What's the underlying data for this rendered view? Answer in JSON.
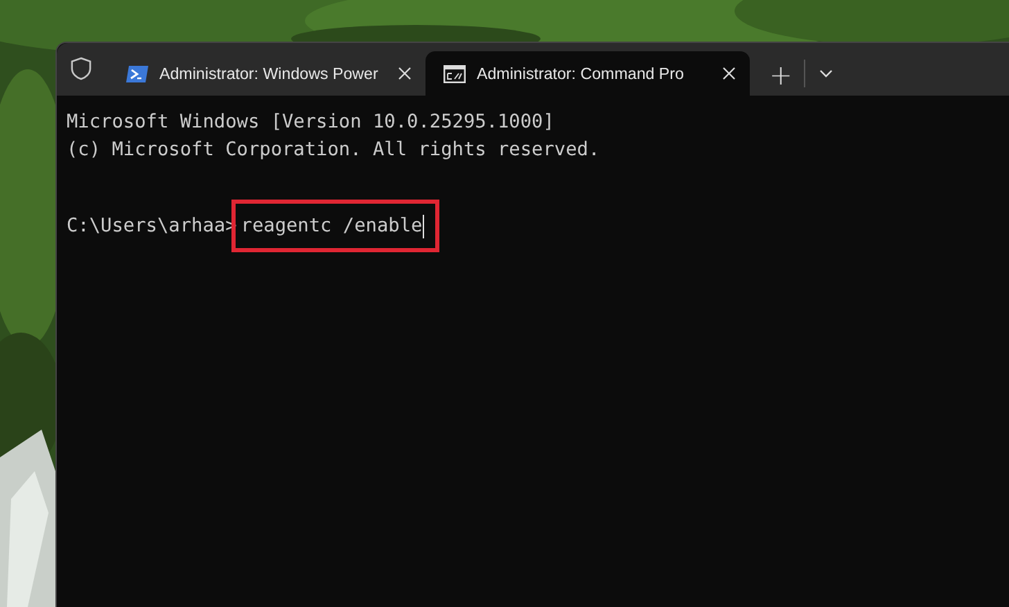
{
  "tabs": [
    {
      "title": "Administrator: Windows Power",
      "selected": false
    },
    {
      "title": "Administrator: Command Pro",
      "selected": true
    }
  ],
  "new_tab": "+",
  "terminal": {
    "lines": [
      "Microsoft Windows [Version 10.0.25295.1000]",
      "(c) Microsoft Corporation. All rights reserved."
    ],
    "prompt": "C:\\Users\\arhaa>",
    "command": "reagentc /enable",
    "highlighted": true
  }
}
